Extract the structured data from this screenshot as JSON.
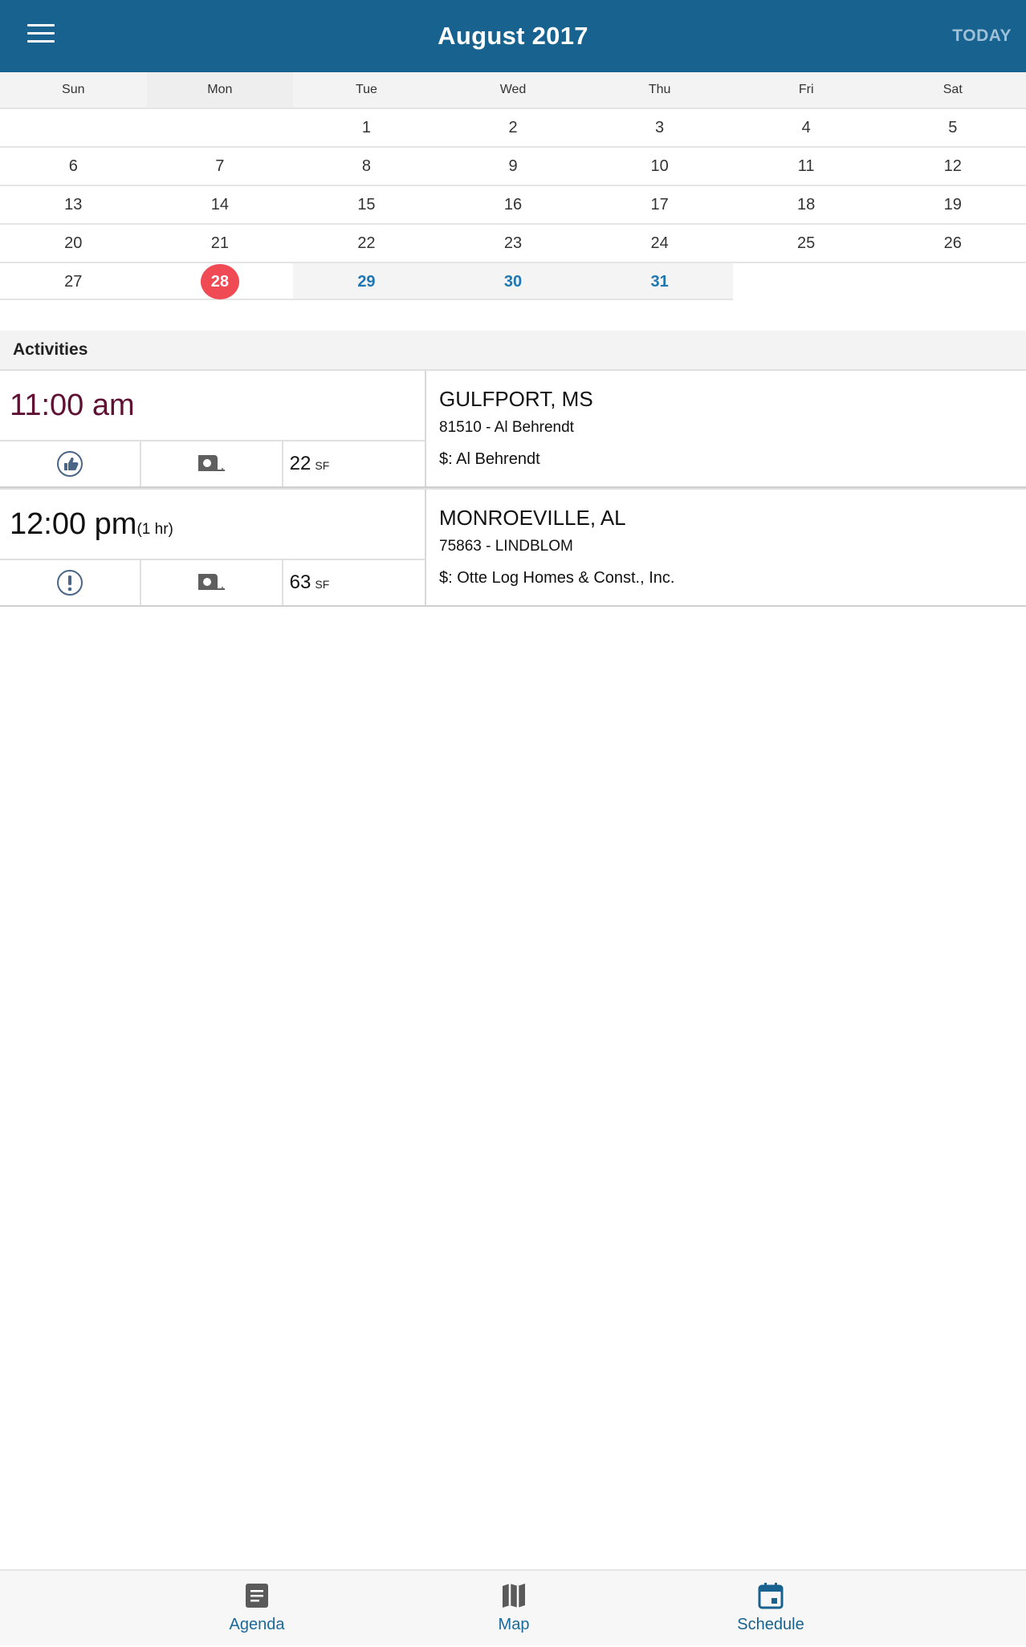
{
  "header": {
    "title": "August 2017",
    "today_label": "TODAY"
  },
  "calendar": {
    "weekdays": [
      "Sun",
      "Mon",
      "Tue",
      "Wed",
      "Thu",
      "Fri",
      "Sat"
    ],
    "weeks": [
      [
        "",
        "",
        "1",
        "2",
        "3",
        "4",
        "5"
      ],
      [
        "6",
        "7",
        "8",
        "9",
        "10",
        "11",
        "12"
      ],
      [
        "13",
        "14",
        "15",
        "16",
        "17",
        "18",
        "19"
      ],
      [
        "20",
        "21",
        "22",
        "23",
        "24",
        "25",
        "26"
      ],
      [
        "27",
        "28",
        "29",
        "30",
        "31",
        "",
        ""
      ]
    ],
    "selected_day": "28",
    "colors": {
      "header": "#17628f",
      "today_circle": "#f04b55",
      "future": "#1e77b3"
    }
  },
  "activities": {
    "heading": "Activities",
    "items": [
      {
        "time": "11:00 am",
        "duration": "",
        "time_color": "#5e1133",
        "status_icon": "thumbs-up-icon",
        "measure_icon": "tape-measure-icon",
        "sf_value": "22",
        "sf_unit": "SF",
        "city": "GULFPORT, MS",
        "job": "81510 - Al Behrendt",
        "customer": "$: Al Behrendt"
      },
      {
        "time": "12:00 pm",
        "duration": "(1 hr)",
        "time_color": "#111111",
        "status_icon": "exclamation-icon",
        "measure_icon": "tape-measure-icon",
        "sf_value": "63",
        "sf_unit": "SF",
        "city": "MONROEVILLE, AL",
        "job": "75863 - LINDBLOM",
        "customer": "$: Otte Log Homes & Const., Inc."
      }
    ]
  },
  "bottom_nav": {
    "items": [
      {
        "label": "Agenda",
        "icon": "agenda-icon"
      },
      {
        "label": "Map",
        "icon": "map-icon"
      },
      {
        "label": "Schedule",
        "icon": "calendar-icon",
        "active": true
      }
    ],
    "colors": {
      "inactive": "#1a6a9c",
      "active": "#17628f",
      "icon_inactive": "#555555"
    }
  }
}
